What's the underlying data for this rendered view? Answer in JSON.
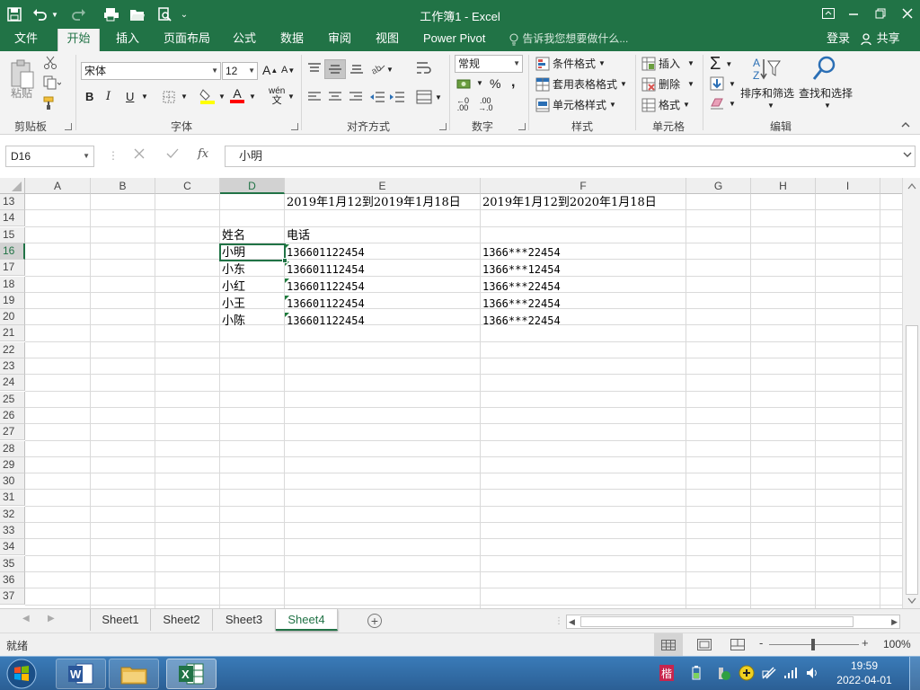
{
  "window": {
    "title": "工作簿1 - Excel",
    "accent": "#217346"
  },
  "menu": {
    "tabs": [
      {
        "label": "文件"
      },
      {
        "label": "开始"
      },
      {
        "label": "插入"
      },
      {
        "label": "页面布局"
      },
      {
        "label": "公式"
      },
      {
        "label": "数据"
      },
      {
        "label": "审阅"
      },
      {
        "label": "视图"
      },
      {
        "label": "Power Pivot"
      }
    ],
    "active_tab": "开始",
    "tell_me": "告诉我您想要做什么...",
    "login": "登录",
    "share": "共享"
  },
  "ribbon": {
    "clipboard": {
      "paste": "粘贴",
      "label": "剪贴板"
    },
    "font": {
      "name": "宋体",
      "size": "12",
      "label": "字体",
      "bold": "B",
      "italic": "I",
      "underline": "U",
      "font_color": "#ff0000",
      "fill_color": "#ffff00",
      "phonetic": "wén"
    },
    "alignment": {
      "label": "对齐方式"
    },
    "number": {
      "format": "常规",
      "percent": "%",
      "comma": ",",
      "label": "数字"
    },
    "styles": {
      "conditional": "条件格式",
      "table": "套用表格格式",
      "cell_styles": "单元格样式",
      "label": "样式"
    },
    "cells": {
      "insert": "插入",
      "delete": "删除",
      "format": "格式",
      "label": "单元格"
    },
    "editing": {
      "sort": "排序和筛选",
      "find": "查找和选择",
      "label": "编辑"
    }
  },
  "formula_bar": {
    "name_box": "D16",
    "fx": "fx",
    "content": "小明"
  },
  "sheet": {
    "columns": [
      "A",
      "B",
      "C",
      "D",
      "E",
      "F",
      "G",
      "H",
      "I"
    ],
    "selected_column": "D",
    "rows": [
      "13",
      "14",
      "15",
      "16",
      "17",
      "18",
      "19",
      "20",
      "21",
      "22",
      "23",
      "24",
      "25",
      "26",
      "27",
      "28",
      "29",
      "30",
      "31",
      "32",
      "33",
      "34",
      "35",
      "36",
      "37"
    ],
    "selected_row": "16",
    "selected_cell": "D16",
    "cells": {
      "E13": "2019年1月12到2019年1月18日",
      "F13": "2019年1月12到2020年1月18日",
      "D15": "姓名",
      "E15": "电话",
      "D16": "小明",
      "E16": "136601122454",
      "F16": "1366***22454",
      "D17": "小东",
      "E17": "136601112454",
      "F17": "1366***12454",
      "D18": "小红",
      "E18": "136601122454",
      "F18": "1366***22454",
      "D19": "小王",
      "E19": "136601122454",
      "F19": "1366***22454",
      "D20": "小陈",
      "E20": "136601122454",
      "F20": "1366***22454"
    }
  },
  "sheet_tabs": {
    "tabs": [
      "Sheet1",
      "Sheet2",
      "Sheet3",
      "Sheet4"
    ],
    "active": "Sheet4",
    "add": "+"
  },
  "status": {
    "ready": "就绪",
    "zoom": "100%",
    "minus": "-",
    "plus": "+"
  },
  "taskbar": {
    "time": "19:59",
    "date": "2022-04-01",
    "apps": [
      "word-app",
      "file-explorer",
      "excel-app"
    ]
  }
}
